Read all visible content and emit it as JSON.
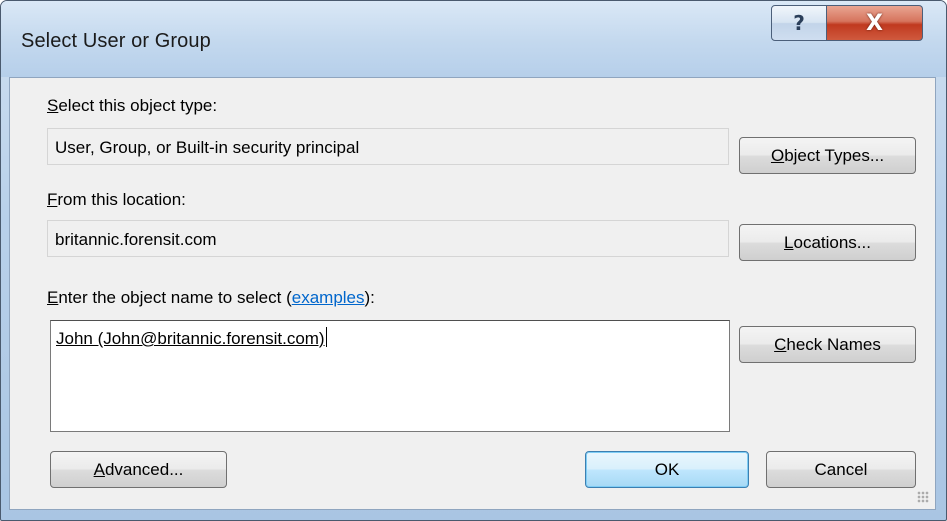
{
  "window": {
    "title": "Select User or Group",
    "help_icon": "?",
    "close_icon": "X"
  },
  "object_type": {
    "label_accel": "S",
    "label_rest": "elect this object type:",
    "value": "User, Group, or Built-in security principal",
    "button_accel": "O",
    "button_rest": "bject Types..."
  },
  "location": {
    "label_accel": "F",
    "label_rest": "rom this location:",
    "value": "britannic.forensit.com",
    "button_accel": "L",
    "button_rest": "ocations..."
  },
  "object_name": {
    "label_accel": "E",
    "label_rest": "nter the object name to select (",
    "link": "examples",
    "label_tail": "):",
    "entry": "John (John@britannic.forensit.com)",
    "button_accel": "C",
    "button_rest": "heck Names"
  },
  "footer": {
    "advanced_accel": "A",
    "advanced_rest": "dvanced...",
    "ok": "OK",
    "cancel": "Cancel"
  },
  "colors": {
    "link": "#0066cc",
    "close_button": "#c0391f",
    "default_button_border": "#3c7fb1"
  }
}
